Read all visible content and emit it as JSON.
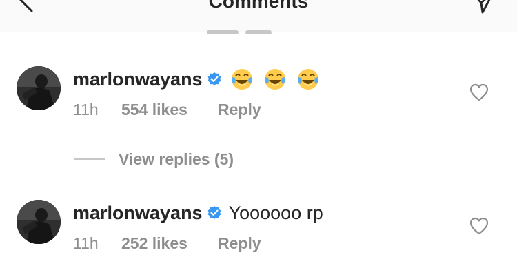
{
  "header": {
    "title": "Comments"
  },
  "comments": [
    {
      "username": "marlonwayans",
      "text": "😂 😂 😂",
      "time": "11h",
      "likes": "554 likes",
      "reply": "Reply",
      "verified": true
    },
    {
      "username": "marlonwayans",
      "text": "Yoooooo rp",
      "time": "11h",
      "likes": "252 likes",
      "reply": "Reply",
      "verified": true
    }
  ],
  "view_replies": {
    "label": "View replies (5)"
  },
  "colors": {
    "text": "#262626",
    "secondary": "#8e8e8e",
    "verified": "#3897f0",
    "divider": "#dbdbdb"
  },
  "icons": [
    "back-arrow-icon",
    "direct-send-icon",
    "verified-badge-icon",
    "heart-outline-icon",
    "face-with-tears-of-joy-icon"
  ]
}
